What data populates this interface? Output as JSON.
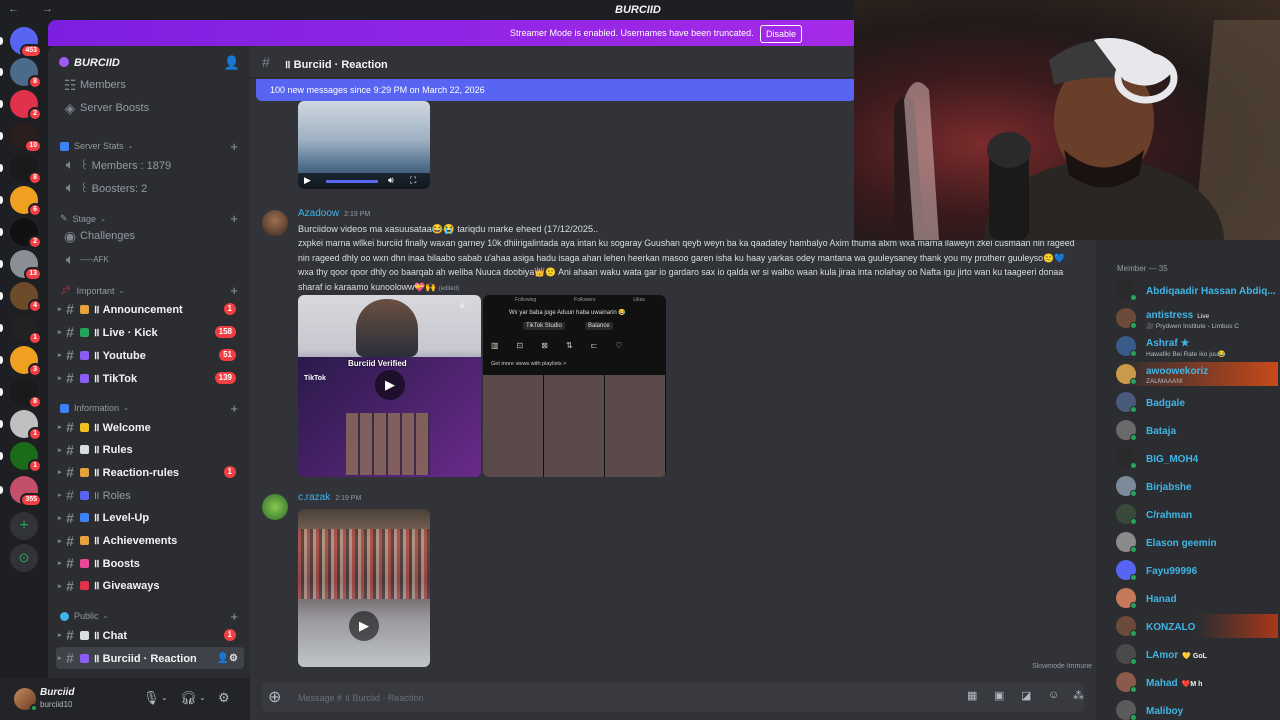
{
  "window": {
    "title": "BURCIID",
    "nav": "← →"
  },
  "banner": {
    "text": "Streamer Mode is enabled. Usernames have been truncated.",
    "button": "Disable"
  },
  "rail": {
    "servers": [
      {
        "badge": "453",
        "color": "#5865f2"
      },
      {
        "badge": "8",
        "color": "#4a6b8a"
      },
      {
        "badge": "2",
        "color": "#e0324a"
      },
      {
        "badge": "10",
        "color": "#2b1e1e"
      },
      {
        "badge": "8",
        "color": "#1a1a1a"
      },
      {
        "badge": "6",
        "color": "#f0a020"
      },
      {
        "badge": "2",
        "color": "#111111"
      },
      {
        "badge": "13",
        "color": "#8a8f96"
      },
      {
        "badge": "4",
        "color": "#6d4a2a"
      },
      {
        "badge": "1",
        "color": "#222222"
      },
      {
        "badge": "3",
        "color": "#f0a020"
      },
      {
        "badge": "8",
        "color": "#1a1a1a"
      },
      {
        "badge": "1",
        "color": "#c0c0c0"
      },
      {
        "badge": "1",
        "color": "#1a6b1a"
      },
      {
        "badge": "355",
        "color": "#c44f6a"
      }
    ]
  },
  "sidebar": {
    "guild_name": "BURCIID",
    "top_items": [
      {
        "label": "Members"
      },
      {
        "label": "Server Boosts"
      }
    ],
    "categories": {
      "server_stats": "Server Stats",
      "stage": "Stage",
      "important": "Important",
      "information": "Information",
      "public": "Public"
    },
    "stats": [
      {
        "label": "꒰ Members : 1879"
      },
      {
        "label": "꒰ Boosters: 2"
      }
    ],
    "stage_items": [
      {
        "label": "Challenges"
      },
      {
        "label": "-----AFK"
      }
    ],
    "important_items": [
      {
        "label": "॥ Announcement",
        "badge": "1",
        "icon_color": "#e6a23c"
      },
      {
        "label": "॥ Live · Kick",
        "badge": "158",
        "icon_color": "#23a55a"
      },
      {
        "label": "॥ Youtube",
        "badge": "51",
        "icon_color": "#8b5cf6"
      },
      {
        "label": "॥ TikTok",
        "badge": "139",
        "icon_color": "#8b5cf6"
      }
    ],
    "information_items": [
      {
        "label": "॥ Welcome",
        "badge": "",
        "icon_color": "#f0c020",
        "unread": true
      },
      {
        "label": "॥ Rules",
        "badge": "",
        "icon_color": "#dbdee1",
        "unread": true
      },
      {
        "label": "॥ Reaction-rules",
        "badge": "1",
        "icon_color": "#e6a23c",
        "unread": true
      },
      {
        "label": "॥ Roles",
        "badge": "",
        "icon_color": "#5865f2",
        "unread": false
      },
      {
        "label": "॥ Level-Up",
        "badge": "",
        "icon_color": "#3b82f6",
        "unread": true
      },
      {
        "label": "॥ Achievements",
        "badge": "",
        "icon_color": "#e6a23c",
        "unread": true
      },
      {
        "label": "॥ Boosts",
        "badge": "",
        "icon_color": "#ec4899",
        "unread": true
      },
      {
        "label": "॥ Giveaways",
        "badge": "",
        "icon_color": "#e0324a",
        "unread": true
      }
    ],
    "public_items": [
      {
        "label": "॥ Chat",
        "badge": "1",
        "icon_color": "#dbdee1"
      },
      {
        "label": "॥ Burciid · Reaction",
        "badge": "",
        "icon_color": "#8b5cf6"
      }
    ]
  },
  "user": {
    "name": "Burciid",
    "handle": "burciid10"
  },
  "chat": {
    "channel_name": "॥ Burciid · Reaction",
    "new_messages": "100 new messages since 9:29 PM on March 22, 2026",
    "messages": [
      {
        "author": "Azadoow",
        "time": "2:19 PM",
        "line1": "Burciidow videos ma xasuusataa😂😭 tariqdu marke eheed (17/12/2025..",
        "body": "zxpkei marna wllkei burciid finally waxan garney 10k dhiirigalintada aya intan ku sogaray Guushan qeyb weyn ba ka qaadatey hambalyo Axim thuma alxm wxa marna ilaweyn zkei cusmaan nin rageed nin rageed dhly oo wxn dhn inaa bilaabo sabab u'ahaa asiga hadu isaga ahan lehen heerkan masoo garen isha ku haay yarkas odey mantana wa guuleysaney thank you my protherr guuleyso🙂💙wxa thy qoor qoor dhly oo baarqab ah weliba Nuuca doobiya👑🙂 Ani ahaan waku wata gar io gardaro sax io qalda wr si walbo waan kula jiraa inta nolahay oo Nafta igu jirto wan ku taageeri donaa sharaf io karaamo kunooloww💝🙌",
        "edited": "(edited)"
      },
      {
        "author": "c.razak",
        "time": "2:19 PM"
      }
    ],
    "attachment": {
      "verified_label": "Burciid Verified",
      "tiktok_label": "TikTok",
      "wx_text": "Wx yar baba joge Aduun haba uwainarin 😂",
      "studio": "TikTok Studio",
      "balance": "Balance",
      "playlists": "Get more views with playlists >",
      "col_following": "Following",
      "col_followers": "Followers",
      "col_likes": "Likes"
    },
    "composer_placeholder": "Message # ॥ Burciid · Reaction",
    "slowmode": "Slowmode Immune"
  },
  "members": {
    "header": "Member — 35",
    "list": [
      {
        "name": "Abdiqaadir Hassan Abdiq...",
        "sub": "",
        "color": "#41b4e6",
        "av": "#2a2a2a"
      },
      {
        "name": "antistress",
        "sub": "🎥 Prydwen Institute - Limbus C",
        "live": "Live",
        "color": "#41b4e6",
        "av": "#6b4a3a"
      },
      {
        "name": "Ashraf ★",
        "sub": "Hawafiki Bei Rate iko juu😂",
        "color": "#41b4e6",
        "av": "#3a5a8a"
      },
      {
        "name": "awoowekoriz",
        "sub": "ZALMAAAN!",
        "color": "#41b4e6",
        "av": "#c99a4a"
      },
      {
        "name": "Badgale",
        "sub": "",
        "color": "#41b4e6",
        "av": "#4a5a7a"
      },
      {
        "name": "Bataja",
        "sub": "",
        "color": "#41b4e6",
        "av": "#6a6a6a"
      },
      {
        "name": "BIG_MOH4",
        "sub": "",
        "color": "#41b4e6",
        "av": "#2a2a2a"
      },
      {
        "name": "Birjabshe",
        "sub": "",
        "color": "#41b4e6",
        "av": "#7a8a9a"
      },
      {
        "name": "C/rahman",
        "sub": "",
        "color": "#41b4e6",
        "av": "#3a4a3a"
      },
      {
        "name": "Elason geemin",
        "sub": "",
        "color": "#41b4e6",
        "av": "#8a8a8a"
      },
      {
        "name": "Fayu99996",
        "sub": "",
        "color": "#41b4e6",
        "av": "#5865f2"
      },
      {
        "name": "Hanad",
        "sub": "",
        "color": "#41b4e6",
        "av": "#c47a5a"
      },
      {
        "name": "KONZALO",
        "sub": "",
        "color": "#41b4e6",
        "av": "#6a4a3a"
      },
      {
        "name": "LAmor",
        "tag": "💛 GoL",
        "sub": "",
        "color": "#41b4e6",
        "av": "#4a4a4a"
      },
      {
        "name": "Mahad",
        "tag": "❤️M h",
        "sub": "",
        "color": "#41b4e6",
        "av": "#8a5a4a"
      },
      {
        "name": "Maliboy",
        "sub": "",
        "color": "#41b4e6",
        "av": "#5a5a5a"
      }
    ]
  }
}
